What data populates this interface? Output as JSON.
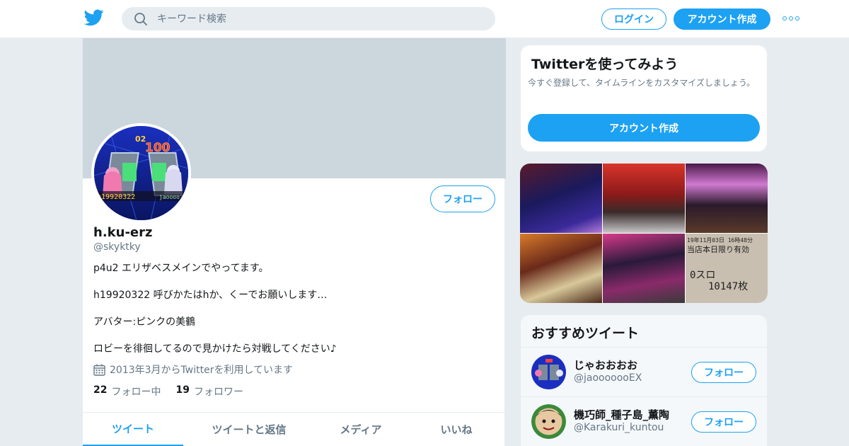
{
  "colors": {
    "accent": "#1da1f2",
    "background": "#e6ecf0",
    "banner": "#ccd6dd",
    "muted": "#657786"
  },
  "header": {
    "logo_icon": "twitter-bird-icon",
    "search": {
      "placeholder": "キーワード検索",
      "value": ""
    },
    "login_label": "ログイン",
    "signup_label": "アカウント作成",
    "more_icon": "more-dots-icon"
  },
  "profile": {
    "follow_label": "フォロー",
    "name": "h.ku-erz",
    "handle": "@skyktky",
    "bio": [
      "p4u2 エリザベスメインでやってます。",
      "h19920322 呼びかたはhか、くーでお願いします…",
      "アバター:ピンクの美鶴",
      "ロビーを徘徊してるので見かけたら対戦してください♪"
    ],
    "joined": "2013年3月からTwitterを利用しています",
    "avatar_text": {
      "top": "02",
      "score": "100",
      "left_id": "h19920322",
      "right_id": "jaoooo"
    },
    "stats": {
      "following": {
        "count": "22",
        "label": "フォロー中"
      },
      "followers": {
        "count": "19",
        "label": "フォロワー"
      }
    },
    "tabs": [
      "ツイート",
      "ツイートと返信",
      "メディア",
      "いいね"
    ],
    "active_tab": "ツイート"
  },
  "signup_card": {
    "title": "Twitterを使ってみよう",
    "description": "今すぐ登録して、タイムラインをカスタマイズしましょう。",
    "button_label": "アカウント作成"
  },
  "media": {
    "receipt": {
      "line1": "19年11月03日 16時48分",
      "line2": "当店本日限り有効",
      "line3": "0スロ",
      "line4": "10147枚"
    }
  },
  "recommended": {
    "title": "おすすめツイート",
    "follow_label": "フォロー",
    "users": [
      {
        "name": "じゃおおおお",
        "handle": "@jaooooooEX"
      },
      {
        "name": "機巧師_種子島_薫陶",
        "handle": "@Karakuri_kuntou"
      }
    ]
  }
}
